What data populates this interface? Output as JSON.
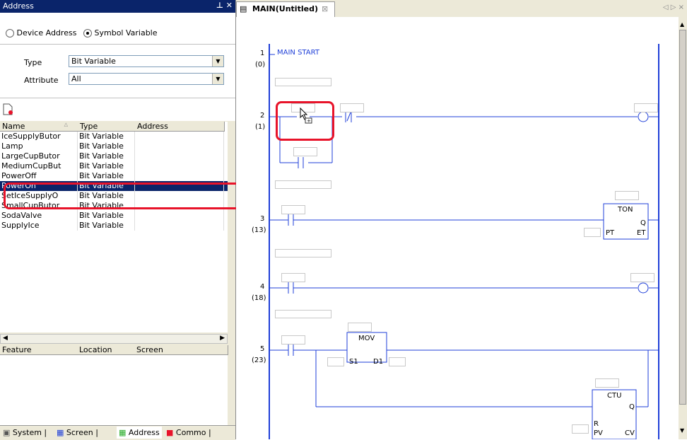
{
  "address_panel": {
    "title": "Address",
    "title_buttons": " † ×",
    "radio_device": "Device Address",
    "radio_symbol": "Symbol Variable",
    "type_label": "Type",
    "type_value": "Bit Variable",
    "attribute_label": "Attribute",
    "attribute_value": "All",
    "columns": [
      "Name",
      "Type",
      "Address"
    ],
    "rows": [
      {
        "name": "IceSupplyButor",
        "type": "Bit Variable"
      },
      {
        "name": "Lamp",
        "type": "Bit Variable"
      },
      {
        "name": "LargeCupButor",
        "type": "Bit Variable"
      },
      {
        "name": "MediumCupBut",
        "type": "Bit Variable"
      },
      {
        "name": "PowerOff",
        "type": "Bit Variable"
      },
      {
        "name": "PowerOn",
        "type": "Bit Variable"
      },
      {
        "name": "SetIceSupplyO",
        "type": "Bit Variable"
      },
      {
        "name": "SmallCupButor",
        "type": "Bit Variable"
      },
      {
        "name": "SodaValve",
        "type": "Bit Variable"
      },
      {
        "name": "SupplyIce",
        "type": "Bit Variable"
      }
    ],
    "selected_row": "PowerOn",
    "lower_columns": [
      "Feature",
      "Location",
      "Screen"
    ],
    "bottom_tabs": [
      "System",
      "Screen",
      "Address",
      "Commo"
    ]
  },
  "editor": {
    "tab_title": "MAIN(Untitled)",
    "rungs": [
      {
        "num": "1",
        "step": "(0)",
        "label": "MAIN START"
      },
      {
        "num": "2",
        "step": "(1)"
      },
      {
        "num": "3",
        "step": "(13)"
      },
      {
        "num": "4",
        "step": "(18)"
      },
      {
        "num": "5",
        "step": "(23)"
      }
    ],
    "ton": {
      "name": "TON",
      "q": "Q",
      "pt": "PT",
      "et": "ET"
    },
    "mov": {
      "name": "MOV",
      "s1": "S1",
      "d1": "D1"
    },
    "ctu": {
      "name": "CTU",
      "q": "Q",
      "r": "R",
      "pv": "PV",
      "cv": "CV"
    },
    "nav_arrows": "◁ ▷ ×"
  },
  "colors": {
    "highlight": "#e8132a",
    "ladder": "#1f3fd8",
    "selection": "#0a246a"
  }
}
